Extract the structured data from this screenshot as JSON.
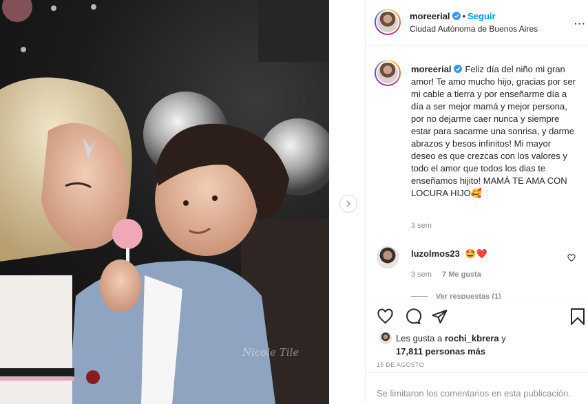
{
  "post": {
    "author": "moreerial",
    "follow_label": "Seguir",
    "separator": "•",
    "location": "Ciudad Autónoma de Buenos Aires",
    "more_label": "···"
  },
  "caption": {
    "author": "moreerial",
    "text": "Feliz día del niño mi gran amor! Te amo mucho hijo, gracias por ser mi cable a tierra y por enseñarme día a día a ser mejor mamá y mejor persona, por no dejarme caer nunca y siempre estar para sacarme una sonrisa, y darme abrazos y besos infinitos! Mi mayor deseo es que crezcas con los valores y todo el amor que todos los dias te enseñamos hijito! MAMÁ TE AMA CON LOCURA HIJO🥰",
    "time": "3 sem"
  },
  "comment": {
    "author": "luzolmos23",
    "text": "🤩❤️",
    "time": "3 sem",
    "likes": "7 Me gusta",
    "view_replies": "Ver respuestas (1)"
  },
  "likes": {
    "prefix": "Les gusta a",
    "user": "rochi_kbrera",
    "conj": "y",
    "count": "17,811 personas más"
  },
  "date": "15 DE AGOSTO",
  "comments_limited": "Se limitaron los comentarios en esta publicación.",
  "photo": {
    "watermark": "Nicole Tile"
  },
  "colors": {
    "link": "#0095f6",
    "verified": "#3897f0",
    "muted": "#8e8e8e",
    "text": "#262626"
  }
}
